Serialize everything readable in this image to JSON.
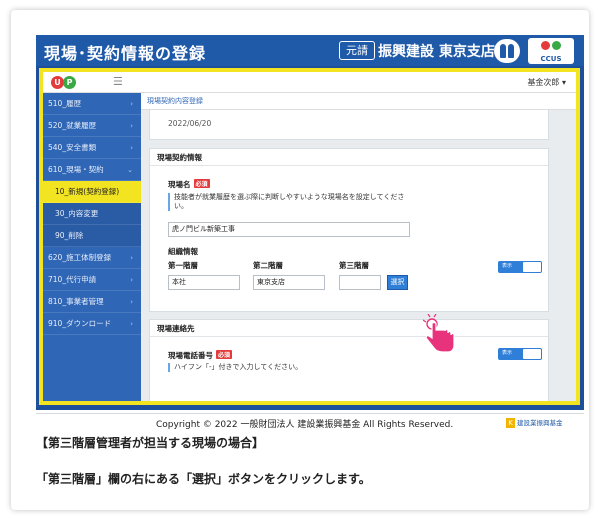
{
  "app": {
    "title": "現場･契約情報の登録",
    "role_badge": "元請",
    "company": "振興建設 東京支店",
    "ccus_label": "CCUS"
  },
  "header": {
    "logo_letters": [
      "U",
      "P"
    ],
    "menu_icon": "hamburger-icon",
    "user_name": "基金次郎 ▾"
  },
  "sidebar": {
    "items": [
      {
        "label": "510_履歴",
        "type": "main"
      },
      {
        "label": "520_就業履歴",
        "type": "main"
      },
      {
        "label": "540_安全書類",
        "type": "main"
      },
      {
        "label": "610_現場・契約",
        "type": "main"
      },
      {
        "label": "10_新規(契約登録)",
        "type": "active"
      },
      {
        "label": "30_内容変更",
        "type": "sub"
      },
      {
        "label": "90_削除",
        "type": "sub"
      },
      {
        "label": "620_施工体制登録",
        "type": "main"
      },
      {
        "label": "710_代行申請",
        "type": "main"
      },
      {
        "label": "810_事業者管理",
        "type": "main"
      },
      {
        "label": "910_ダウンロード",
        "type": "main"
      }
    ]
  },
  "breadcrumb": "現場契約内容登録",
  "date_value": "2022/06/20",
  "contract_section": {
    "title": "現場契約情報",
    "site_name_label": "現場名",
    "required_badge": "必須",
    "site_name_note": "技能者が就業履歴を選ぶ際に判断しやすいような現場名を設定してください。",
    "site_name_value": "虎ノ門ビル新築工事",
    "org_label": "組織情報",
    "tier1_label": "第一階層",
    "tier2_label": "第二階層",
    "tier3_label": "第三階層",
    "tier1_value": "本社",
    "tier2_value": "東京支店",
    "tier3_value": "",
    "select_button": "選択",
    "toggle_label": "表示"
  },
  "contact_section": {
    "title": "現場連絡先",
    "phone_label": "現場電話番号",
    "required_badge": "必須",
    "phone_note": "ハイフン「-」付きで入力してください。",
    "toggle_label": "表示"
  },
  "footer": {
    "copyright": "Copyright © 2022 一般財団法人 建設業振興基金 All Rights Reserved.",
    "fund_name": "建設業振興基金",
    "fund_mark": "K"
  },
  "caption": {
    "heading": "【第三階層管理者が担当する現場の場合】",
    "instruction": "「第三階層」欄の右にある「選択」ボタンをクリックします。"
  },
  "colors": {
    "brand_blue": "#1f5aa8",
    "sidebar_blue": "#2f66b5",
    "highlight_yellow": "#f2e420",
    "required_red": "#e33b3b",
    "cursor_pink": "#e8337c"
  }
}
